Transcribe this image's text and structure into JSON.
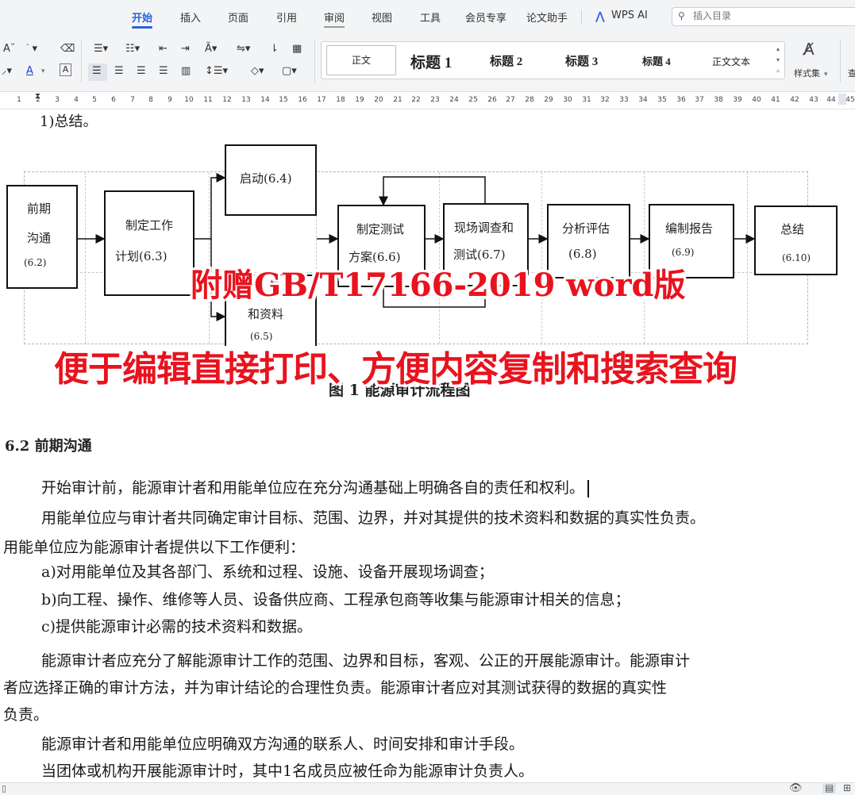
{
  "menu": {
    "tabs": [
      "开始",
      "插入",
      "页面",
      "引用",
      "审阅",
      "视图",
      "工具",
      "会员专享",
      "论文助手"
    ],
    "active_tab": "开始",
    "wps_ai": "WPS AI",
    "search_placeholder": "插入目录"
  },
  "toolbar": {
    "font_color_letter": "A",
    "styles": [
      "正文",
      "标题 1",
      "标题 2",
      "标题 3",
      "标题 4",
      "正文文本"
    ],
    "style_set_label": "样式集",
    "edge_label": "查"
  },
  "ruler": {
    "numbers": [
      "1",
      "2",
      "3",
      "4",
      "5",
      "6",
      "7",
      "8",
      "9",
      "10",
      "11",
      "12",
      "13",
      "14",
      "15",
      "16",
      "17",
      "18",
      "19",
      "20",
      "21",
      "22",
      "23",
      "24",
      "25",
      "26",
      "27",
      "28",
      "29",
      "30",
      "31",
      "32",
      "33",
      "34",
      "35",
      "36",
      "37",
      "38",
      "39",
      "40",
      "41",
      "42",
      "43",
      "44",
      "45"
    ]
  },
  "document": {
    "top_item": "1)总结。",
    "flowchart": {
      "pre_comm": [
        "前期",
        "沟通",
        "(6.2)"
      ],
      "plan": [
        "制定工作",
        "计划(6.3)"
      ],
      "start": "启动(6.4)",
      "data": [
        "数",
        "和资料",
        "(6.5)"
      ],
      "test_plan": [
        "制定测试",
        "方案(6.6)"
      ],
      "onsite": [
        "现场调查和",
        "测试(6.7)"
      ],
      "analysis": [
        "分析评估",
        "(6.8)"
      ],
      "report": [
        "编制报告",
        "(6.9)"
      ],
      "summary": [
        "总结",
        "(6.10)"
      ]
    },
    "figure_caption": "图 1  能源审计流程图",
    "overlay_line1": "附赠GB/T17166-2019 word版",
    "overlay_line2": "便于编辑直接打印、方便内容复制和搜索查询",
    "section_heading": "6.2  前期沟通",
    "paragraphs": [
      "开始审计前，能源审计者和用能单位应在充分沟通基础上明确各自的责任和权利。",
      "用能单位应与审计者共同确定审计目标、范围、边界，并对其提供的技术资料和数据的真实性负责。",
      "用能单位应为能源审计者提供以下工作便利：",
      "a)对用能单位及其各部门、系统和过程、设施、设备开展现场调查；",
      "b)向工程、操作、维修等人员、设备供应商、工程承包商等收集与能源审计相关的信息；",
      "c)提供能源审计必需的技术资料和数据。",
      "能源审计者应充分了解能源审计工作的范围、边界和目标，客观、公正的开展能源审计。能源审计",
      "者应选择正确的审计方法，并为审计结论的合理性负责。能源审计者应对其测试获得的数据的真实性",
      "负责。",
      "能源审计者和用能单位应明确双方沟通的联系人、时间安排和审计手段。",
      "当团体或机构开展能源审计时，其中1名成员应被任命为能源审计负责人。"
    ]
  },
  "colors": {
    "accent": "#2b63d9",
    "overlay_red": "#e8131e"
  }
}
